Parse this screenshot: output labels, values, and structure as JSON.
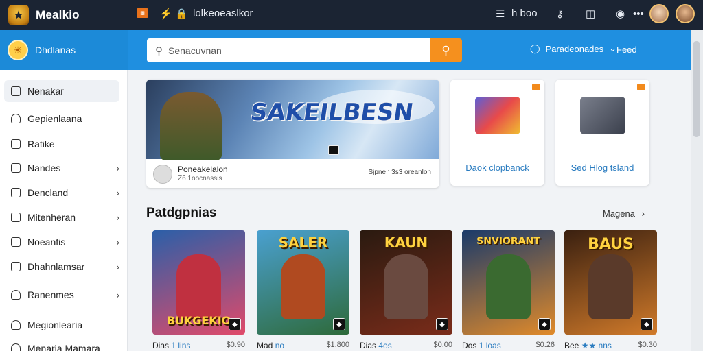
{
  "topbar": {
    "brand": "Mealkio",
    "nav_text": "lolkeoeaslkor",
    "right_text": "h boo"
  },
  "left_header": {
    "title": "Dhdlanas"
  },
  "search": {
    "placeholder": "Senacuvnan"
  },
  "user_menu": {
    "label": "Paradeonades",
    "feed": "Feed"
  },
  "sidebar": {
    "items": [
      {
        "label": "Nenakar",
        "has_chevron": false
      },
      {
        "label": "Gepienlaana",
        "has_chevron": false
      },
      {
        "label": "Ratike",
        "has_chevron": false
      },
      {
        "label": "Nandes",
        "has_chevron": true
      },
      {
        "label": "Dencland",
        "has_chevron": true
      },
      {
        "label": "Mitenheran",
        "has_chevron": true
      },
      {
        "label": "Noeanfis",
        "has_chevron": true
      },
      {
        "label": "Dhahnlamsar",
        "has_chevron": true
      },
      {
        "label": "Ranenmes",
        "has_chevron": true
      },
      {
        "label": "Megionlearia",
        "has_chevron": false
      },
      {
        "label": "Menaria Mamara",
        "has_chevron": false
      }
    ]
  },
  "hero": {
    "title": "SAKEILBESN",
    "author": "Poneakelalon",
    "subtitle": "Z6 1oocnassis",
    "meta": "Sjpne ∶ 3s3 oreanlon"
  },
  "tiles": [
    {
      "label": "Daok clopbanck",
      "art_color": "#5b5fd8"
    },
    {
      "label": "Sed Hlog tsland",
      "art_color": "#4a4f5c"
    }
  ],
  "section": {
    "title": "Patdgpnias",
    "more": "Magena"
  },
  "cards": [
    {
      "title": "BUKGEKIO",
      "name": "Dias",
      "tag": "1 lins",
      "price": "$0.90",
      "bg1": "#2b5fa8",
      "bg2": "#e04a6a",
      "fig": "#c03040"
    },
    {
      "title": "SALER",
      "name": "Mad",
      "tag": "no",
      "price": "$1.800",
      "bg1": "#2e6a3a",
      "bg2": "#4aa0d0",
      "fig": "#b04a20"
    },
    {
      "title": "KAUN",
      "name": "Dias",
      "tag": "4os",
      "price": "$0.00",
      "bg1": "#2a1a10",
      "bg2": "#7a2c1a",
      "fig": "#6a4a40"
    },
    {
      "title": "SNVIORANT",
      "name": "Dos",
      "tag": "1 loas",
      "price": "$0.26",
      "bg1": "#1a3a6a",
      "bg2": "#e08a2a",
      "fig": "#3a6a30"
    },
    {
      "title": "BAUS",
      "name": "Bee",
      "tag": "★★ nns",
      "price": "$0.30",
      "bg1": "#3a2010",
      "bg2": "#d07a2a",
      "fig": "#5a3a2a"
    }
  ]
}
